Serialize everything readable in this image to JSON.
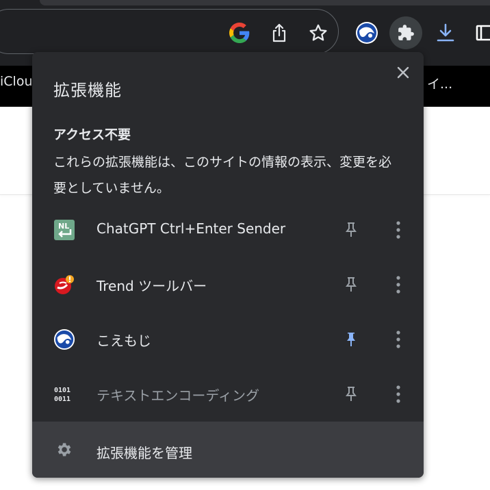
{
  "bookmarks": {
    "left_item": "iClou",
    "right_item": "イ..."
  },
  "popup": {
    "title": "拡張機能",
    "section_heading": "アクセス不要",
    "section_desc": "これらの拡張機能は、このサイトの情報の表示、変更を必要としていません。",
    "extensions": [
      {
        "name": "ChatGPT Ctrl+Enter Sender",
        "icon": "nl-return-icon",
        "pinned": false
      },
      {
        "name": "Trend ツールバー",
        "icon": "trend-micro-icon",
        "pinned": false
      },
      {
        "name": "こえもじ",
        "icon": "koemoji-icon",
        "pinned": true
      },
      {
        "name": "テキストエンコーディング",
        "icon": "binary-encoding-icon",
        "pinned": false
      }
    ],
    "encoding_icon_text": {
      "line1": "0101",
      "line2": "0011"
    },
    "manage_label": "拡張機能を管理"
  },
  "colors": {
    "popup_bg": "#292a2d",
    "manage_bg": "#3c3d41",
    "pin_active": "#8ab4f8",
    "pin_inactive": "#9aa0a6",
    "toolbar_bg": "#202124"
  }
}
